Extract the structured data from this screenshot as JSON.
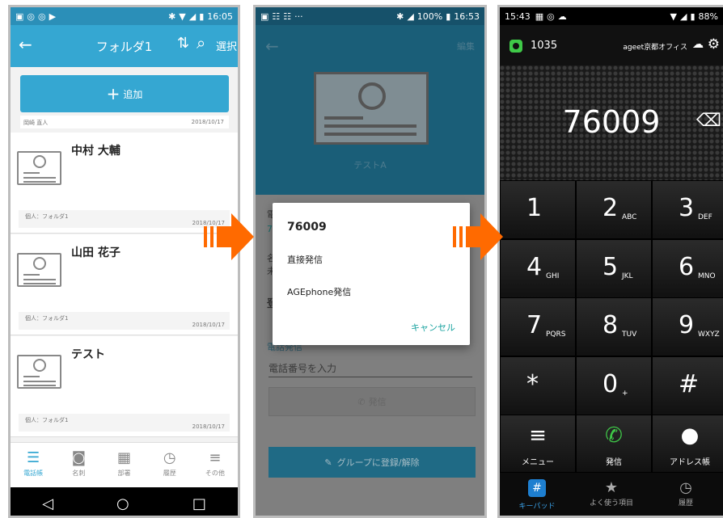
{
  "phone1": {
    "status": {
      "time": "16:05"
    },
    "header": {
      "title": "フォルダ1",
      "select_label": "選択"
    },
    "add_label": "追加",
    "prev_contact": {
      "name": "岡崎 直人",
      "date": "2018/10/17"
    },
    "contacts": [
      {
        "name": "中村 大輔",
        "group": "個人：フォルダ1",
        "date": "2018/10/17"
      },
      {
        "name": "山田 花子",
        "group": "個人：フォルダ1",
        "date": "2018/10/17"
      },
      {
        "name": "テスト",
        "group": "個人：フォルダ1",
        "date": "2018/10/17"
      }
    ],
    "nav": [
      {
        "label": "電話帳",
        "icon": "phonebook-icon"
      },
      {
        "label": "名刺",
        "icon": "business-card-icon"
      },
      {
        "label": "部署",
        "icon": "building-icon"
      },
      {
        "label": "履歴",
        "icon": "clock-icon"
      },
      {
        "label": "その他",
        "icon": "menu-icon"
      }
    ]
  },
  "phone2": {
    "status": {
      "battery": "100%",
      "time": "16:53"
    },
    "edit_label": "編集",
    "contact_name": "テストA",
    "phone_call_label": "電話発信",
    "phone_placeholder": "電話番号を入力",
    "call_button_label": "発信",
    "group_button_label": "グループに登録/解除",
    "dialog": {
      "number": "76009",
      "options": [
        "直接発信",
        "AGEphone発信"
      ],
      "cancel_label": "キャンセル"
    }
  },
  "phone3": {
    "status": {
      "time": "15:43",
      "battery": "88%"
    },
    "extension": "1035",
    "office": "ageet京都オフィス",
    "dialed_number": "76009",
    "keys": [
      {
        "digit": "1",
        "letters": ""
      },
      {
        "digit": "2",
        "letters": "ABC"
      },
      {
        "digit": "3",
        "letters": "DEF"
      },
      {
        "digit": "4",
        "letters": "GHI"
      },
      {
        "digit": "5",
        "letters": "JKL"
      },
      {
        "digit": "6",
        "letters": "MNO"
      },
      {
        "digit": "7",
        "letters": "PQRS"
      },
      {
        "digit": "8",
        "letters": "TUV"
      },
      {
        "digit": "9",
        "letters": "WXYZ"
      },
      {
        "digit": "*",
        "letters": ""
      },
      {
        "digit": "0",
        "letters": "+"
      },
      {
        "digit": "#",
        "letters": ""
      }
    ],
    "function_keys": {
      "menu": "メニュー",
      "call": "発信",
      "address": "アドレス帳"
    },
    "tabs": {
      "keypad": "キーパッド",
      "favorites": "よく使う項目",
      "history": "履歴"
    }
  },
  "colors": {
    "accent": "#35a7d2",
    "arrow": "#ff6a00",
    "call_green": "#3fc948",
    "dialog_accent": "#1aa3a0"
  }
}
